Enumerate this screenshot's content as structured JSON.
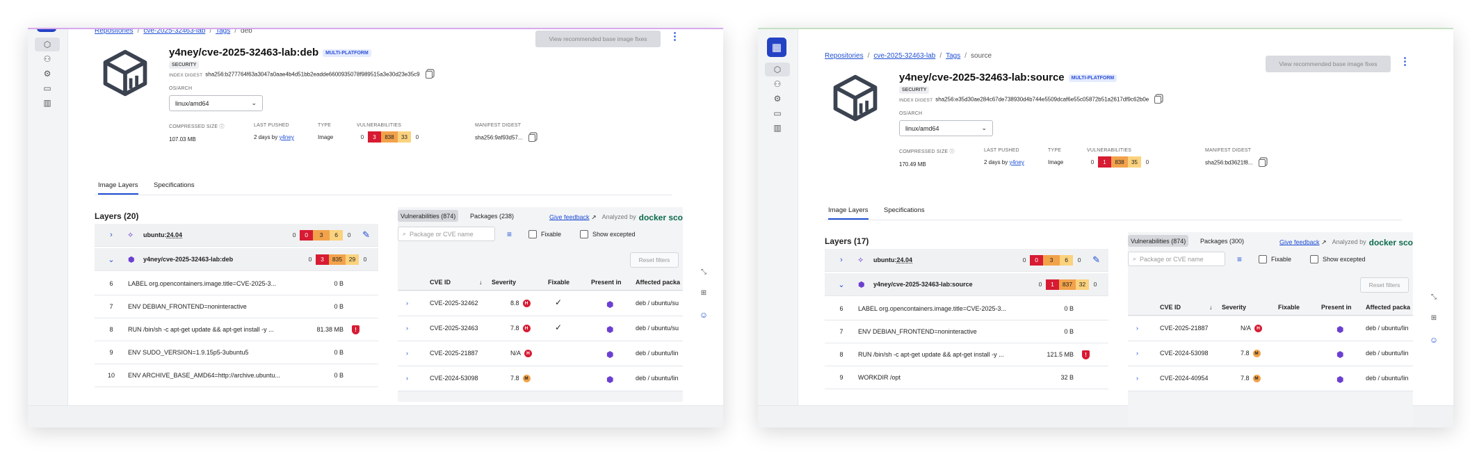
{
  "left": {
    "breadcrumb": [
      "Repositories",
      "cve-2025-32463-lab",
      "Tags",
      "deb"
    ],
    "title": "y4ney/cve-2025-32463-lab:deb",
    "multi_platform": "MULTI-PLATFORM",
    "security": "SECURITY",
    "index_digest_label": "INDEX DIGEST",
    "index_digest": "sha256:b277764f63a3047a0aae4b4d51bb2eadde6600935078f989515a3e30d23e35c9",
    "os_arch_label": "OS/ARCH",
    "os_arch": "linux/amd64",
    "stats": {
      "compressed_label": "COMPRESSED SIZE",
      "compressed": "107.03 MB",
      "pushed_label": "LAST PUSHED",
      "pushed": "2 days by",
      "pushed_user": "y4ney",
      "type_label": "TYPE",
      "type": "Image",
      "vuln_label": "VULNERABILITIES",
      "vulns": [
        "0",
        "3",
        "838",
        "33",
        "0"
      ],
      "manifest_label": "MANIFEST DIGEST",
      "manifest": "sha256:9af93d57..."
    },
    "rec_button": "View recommended base image fixes",
    "tabs": [
      "Image Layers",
      "Specifications"
    ],
    "layers_title": "Layers (20)",
    "base": {
      "name": "ubuntu",
      "tag": "24.04",
      "vulns": [
        "0",
        "0",
        "3",
        "6",
        "0"
      ]
    },
    "image": {
      "name": "y4ney/cve-2025-32463-lab",
      "tag": "deb",
      "vulns": [
        "0",
        "3",
        "835",
        "29",
        "0"
      ]
    },
    "layers": [
      {
        "num": "6",
        "cmd": "LABEL org.opencontainers.image.title=CVE-2025-3...",
        "size": "0 B"
      },
      {
        "num": "7",
        "cmd": "ENV DEBIAN_FRONTEND=noninteractive",
        "size": "0 B"
      },
      {
        "num": "8",
        "cmd": "RUN /bin/sh -c apt-get update && apt-get install -y ...",
        "size": "81.38 MB"
      },
      {
        "num": "9",
        "cmd": "ENV SUDO_VERSION=1.9.15p5-3ubuntu5",
        "size": "0 B"
      },
      {
        "num": "10",
        "cmd": "ENV ARCHIVE_BASE_AMD64=http://archive.ubuntu...",
        "size": "0 B"
      }
    ],
    "vtabs": [
      "Vulnerabilities (874)",
      "Packages (238)"
    ],
    "feedback": "Give feedback",
    "analyzed": "Analyzed by",
    "scout": "docker scout",
    "search_placeholder": "Package or CVE name",
    "fixable": "Fixable",
    "show_excepted": "Show excepted",
    "reset": "Reset filters",
    "cols": [
      "CVE ID",
      "Severity",
      "Fixable",
      "Present in",
      "Affected packa"
    ],
    "cves": [
      {
        "id": "CVE-2025-32462",
        "sev": "8.8",
        "lvl": "H",
        "fix": "✓",
        "pkg": "deb / ubuntu/su"
      },
      {
        "id": "CVE-2025-32463",
        "sev": "7.8",
        "lvl": "H",
        "fix": "✓",
        "pkg": "deb / ubuntu/su"
      },
      {
        "id": "CVE-2025-21887",
        "sev": "N/A",
        "lvl": "H",
        "fix": "",
        "pkg": "deb / ubuntu/lin"
      },
      {
        "id": "CVE-2024-53098",
        "sev": "7.8",
        "lvl": "M",
        "fix": "",
        "pkg": "deb / ubuntu/lin"
      }
    ]
  },
  "right": {
    "breadcrumb": [
      "Repositories",
      "cve-2025-32463-lab",
      "Tags",
      "source"
    ],
    "title": "y4ney/cve-2025-32463-lab:source",
    "multi_platform": "MULTI-PLATFORM",
    "security": "SECURITY",
    "index_digest_label": "INDEX DIGEST",
    "index_digest": "sha256:e35d30ae284c67de738930d4b744e5509dcaf6e55c05872b51a2617df9c62b0e",
    "os_arch_label": "OS/ARCH",
    "os_arch": "linux/amd64",
    "stats": {
      "compressed_label": "COMPRESSED SIZE",
      "compressed": "170.49 MB",
      "pushed_label": "LAST PUSHED",
      "pushed": "2 days by",
      "pushed_user": "y4ney",
      "type_label": "TYPE",
      "type": "Image",
      "vuln_label": "VULNERABILITIES",
      "vulns": [
        "0",
        "1",
        "838",
        "35",
        "0"
      ],
      "manifest_label": "MANIFEST DIGEST",
      "manifest": "sha256:bd3621f8..."
    },
    "rec_button": "View recommended base image fixes",
    "tabs": [
      "Image Layers",
      "Specifications"
    ],
    "layers_title": "Layers (17)",
    "base": {
      "name": "ubuntu",
      "tag": "24.04",
      "vulns": [
        "0",
        "0",
        "3",
        "6",
        "0"
      ]
    },
    "image": {
      "name": "y4ney/cve-2025-32463-lab",
      "tag": "source",
      "vulns": [
        "0",
        "1",
        "837",
        "32",
        "0"
      ]
    },
    "layers": [
      {
        "num": "6",
        "cmd": "LABEL org.opencontainers.image.title=CVE-2025-3...",
        "size": "0 B"
      },
      {
        "num": "7",
        "cmd": "ENV DEBIAN_FRONTEND=noninteractive",
        "size": "0 B"
      },
      {
        "num": "8",
        "cmd": "RUN /bin/sh -c apt-get update && apt-get install -y ...",
        "size": "121.5 MB"
      },
      {
        "num": "9",
        "cmd": "WORKDIR /opt",
        "size": "32 B"
      }
    ],
    "vtabs": [
      "Vulnerabilities (874)",
      "Packages (300)"
    ],
    "feedback": "Give feedback",
    "analyzed": "Analyzed by",
    "scout": "docker scout",
    "search_placeholder": "Package or CVE name",
    "fixable": "Fixable",
    "show_excepted": "Show excepted",
    "reset": "Reset filters",
    "cols": [
      "CVE ID",
      "Severity",
      "Fixable",
      "Present in",
      "Affected packa"
    ],
    "cves": [
      {
        "id": "CVE-2025-21887",
        "sev": "N/A",
        "lvl": "H",
        "fix": "",
        "pkg": "deb / ubuntu/lin"
      },
      {
        "id": "CVE-2024-53098",
        "sev": "7.8",
        "lvl": "M",
        "fix": "",
        "pkg": "deb / ubuntu/lin"
      },
      {
        "id": "CVE-2024-40954",
        "sev": "7.8",
        "lvl": "M",
        "fix": "",
        "pkg": "deb / ubuntu/lin"
      }
    ]
  },
  "colors": {
    "accent": "#1f4fd4",
    "critical": "#d71b33",
    "high": "#f2a24a",
    "medium": "#fbd27d",
    "image_icon": "#6b3fd1"
  },
  "icons": [
    "cube-icon",
    "docker-logo-icon",
    "copy-icon",
    "chevron-down-icon",
    "chevron-right-icon",
    "shield-alert-icon",
    "filter-icon",
    "wrench-icon",
    "external-link-icon",
    "checkmark-icon"
  ]
}
